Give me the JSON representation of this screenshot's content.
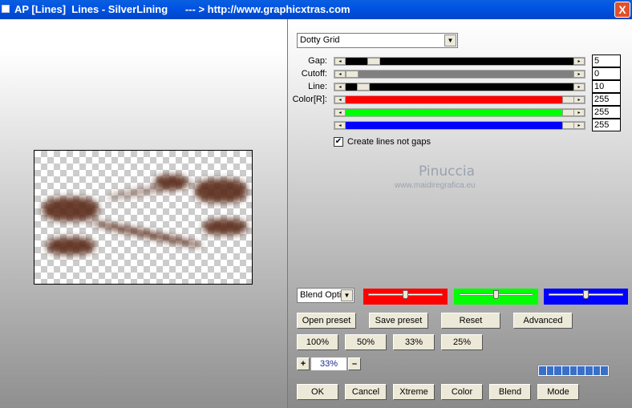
{
  "window": {
    "title": "AP [Lines]  Lines - SilverLining      --- > http://www.graphicxtras.com",
    "close_icon": "X"
  },
  "preset_combo": {
    "value": "Dotty Grid"
  },
  "sliders": [
    {
      "label": "Gap:",
      "value": "5",
      "fraction": 0.1,
      "color": "#000000"
    },
    {
      "label": "Cutoff:",
      "value": "0",
      "fraction": 0.0,
      "color": "#808080"
    },
    {
      "label": "Line:",
      "value": "10",
      "fraction": 0.05,
      "color": "#000000"
    },
    {
      "label": "Color[R]:",
      "value": "255",
      "fraction": 1.0,
      "color": "#ff0000"
    },
    {
      "label": "",
      "value": "255",
      "fraction": 1.0,
      "color": "#00ff00"
    },
    {
      "label": "",
      "value": "255",
      "fraction": 1.0,
      "color": "#0000ff"
    }
  ],
  "checkbox": {
    "label": "Create lines not gaps",
    "checked": true
  },
  "watermark": {
    "name": "Pinuccia",
    "url": "www.maidiregrafica.eu"
  },
  "blend_combo": {
    "value": "Blend Opti"
  },
  "color_sliders": [
    {
      "color": "#ff0000",
      "fraction": 0.5
    },
    {
      "color": "#00ff00",
      "fraction": 0.5
    },
    {
      "color": "#0000ff",
      "fraction": 0.5
    }
  ],
  "buttons": {
    "open_preset": "Open preset",
    "save_preset": "Save preset",
    "reset": "Reset",
    "advanced": "Advanced",
    "z100": "100%",
    "z50": "50%",
    "z33": "33%",
    "z25": "25%",
    "ok": "OK",
    "cancel": "Cancel",
    "xtreme": "Xtreme",
    "color": "Color",
    "blend": "Blend",
    "mode": "Mode"
  },
  "zoom": {
    "plus": "+",
    "value": "33%",
    "minus": "–"
  },
  "progress": {
    "fraction": 1.0
  }
}
